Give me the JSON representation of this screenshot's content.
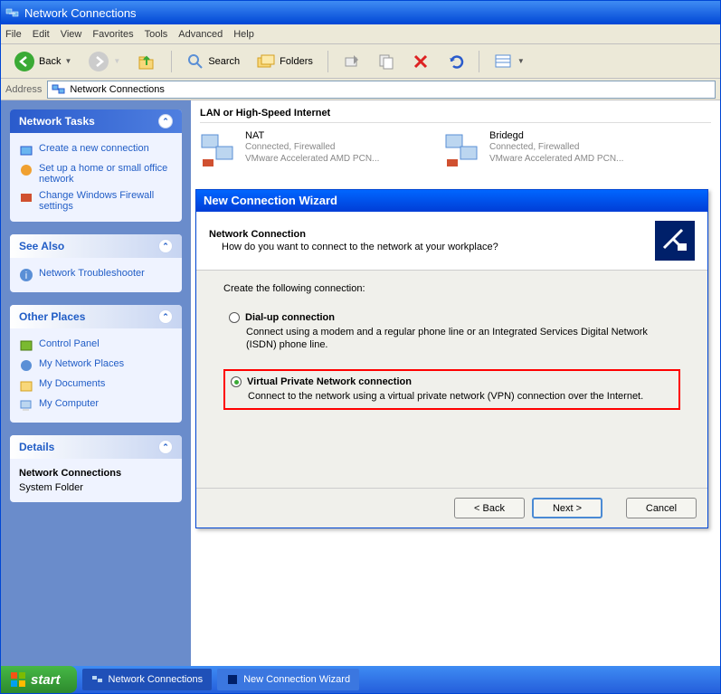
{
  "window": {
    "title": "Network Connections"
  },
  "menubar": [
    "File",
    "Edit",
    "View",
    "Favorites",
    "Tools",
    "Advanced",
    "Help"
  ],
  "toolbar": {
    "back": "Back",
    "search": "Search",
    "folders": "Folders"
  },
  "address": {
    "label": "Address",
    "value": "Network Connections"
  },
  "sidepanel": {
    "tasks": {
      "title": "Network Tasks",
      "items": [
        "Create a new connection",
        "Set up a home or small office network",
        "Change Windows Firewall settings"
      ]
    },
    "seealso": {
      "title": "See Also",
      "items": [
        "Network Troubleshooter"
      ]
    },
    "other": {
      "title": "Other Places",
      "items": [
        "Control Panel",
        "My Network Places",
        "My Documents",
        "My Computer"
      ]
    },
    "details": {
      "title": "Details",
      "name": "Network Connections",
      "type": "System Folder"
    }
  },
  "main": {
    "section": "LAN or High-Speed Internet",
    "connections": [
      {
        "name": "NAT",
        "status": "Connected, Firewalled",
        "adapter": "VMware Accelerated AMD PCN..."
      },
      {
        "name": "Bridegd",
        "status": "Connected, Firewalled",
        "adapter": "VMware Accelerated AMD PCN..."
      }
    ]
  },
  "wizard": {
    "title": "New Connection Wizard",
    "heading": "Network Connection",
    "subheading": "How do you want to connect to the network at your workplace?",
    "instruction": "Create the following connection:",
    "options": [
      {
        "label": "Dial-up connection",
        "desc": "Connect using a modem and a regular phone line or an Integrated Services Digital Network (ISDN) phone line.",
        "selected": false
      },
      {
        "label": "Virtual Private Network connection",
        "desc": "Connect to the network using a virtual private network (VPN) connection over the Internet.",
        "selected": true
      }
    ],
    "buttons": {
      "back": "< Back",
      "next": "Next >",
      "cancel": "Cancel"
    }
  },
  "taskbar": {
    "start": "start",
    "items": [
      "Network Connections",
      "New Connection Wizard"
    ]
  }
}
